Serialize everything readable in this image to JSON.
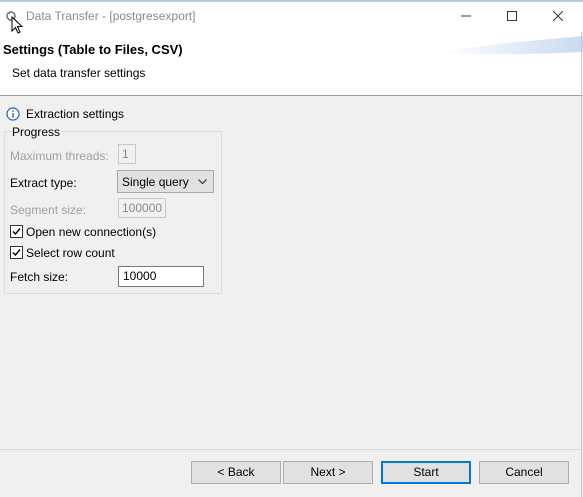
{
  "window": {
    "title": "Data Transfer - [postgresexport]",
    "controls": {
      "minimize_icon": "minimize-icon",
      "maximize_icon": "maximize-icon",
      "close_icon": "close-icon"
    }
  },
  "header": {
    "title": "Settings (Table to Files, CSV)",
    "description": "Set data transfer settings"
  },
  "section": {
    "icon": "info-icon",
    "title": "Extraction settings"
  },
  "progress_group": {
    "label": "Progress",
    "maximum_threads": {
      "label": "Maximum threads:",
      "value": "1",
      "enabled": false
    },
    "extract_type": {
      "label": "Extract type:",
      "value": "Single query"
    },
    "segment_size": {
      "label": "Segment size:",
      "value": "100000",
      "enabled": false
    },
    "open_new_connections": {
      "label": "Open new connection(s)",
      "checked": true
    },
    "select_row_count": {
      "label": "Select row count",
      "checked": true
    },
    "fetch_size": {
      "label": "Fetch size:",
      "value": "10000"
    }
  },
  "buttons": {
    "back": "< Back",
    "next": "Next >",
    "start": "Start",
    "cancel": "Cancel"
  },
  "colors": {
    "content_bg": "#f0f0f0",
    "button_bg": "#e1e1e1",
    "default_button_border": "#0078d7",
    "disabled_text": "#a0a0a0"
  }
}
